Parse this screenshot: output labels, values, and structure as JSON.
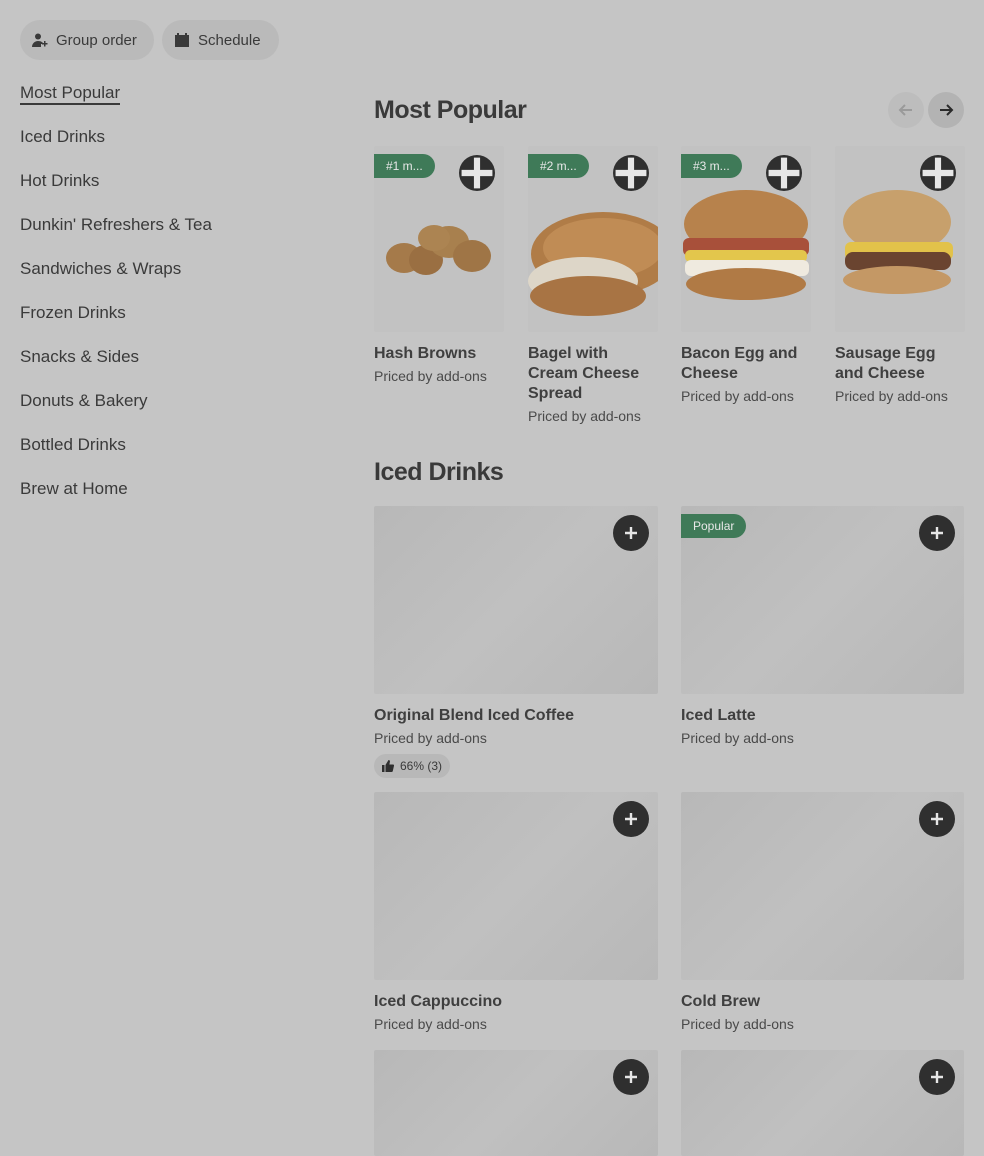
{
  "header": {
    "group_order_label": "Group order",
    "schedule_label": "Schedule"
  },
  "sidebar": {
    "items": [
      {
        "label": "Most Popular",
        "active": true
      },
      {
        "label": "Iced Drinks"
      },
      {
        "label": "Hot Drinks"
      },
      {
        "label": "Dunkin' Refreshers & Tea"
      },
      {
        "label": "Sandwiches & Wraps"
      },
      {
        "label": "Frozen Drinks"
      },
      {
        "label": "Snacks & Sides"
      },
      {
        "label": "Donuts & Bakery"
      },
      {
        "label": "Bottled Drinks"
      },
      {
        "label": "Brew at Home"
      }
    ]
  },
  "most_popular": {
    "title": "Most Popular",
    "items": [
      {
        "badge": "#1 m...",
        "name": "Hash Browns",
        "price": "Priced by add-ons",
        "icon": "hash-browns"
      },
      {
        "badge": "#2 m...",
        "name": "Bagel with Cream Cheese Spread",
        "price": "Priced by add-ons",
        "icon": "bagel"
      },
      {
        "badge": "#3 m...",
        "name": "Bacon Egg and Cheese",
        "price": "Priced by add-ons",
        "icon": "bacon-egg-sandwich"
      },
      {
        "badge": "",
        "name": "Sausage Egg and Cheese",
        "price": "Priced by add-ons",
        "icon": "sausage-sandwich"
      }
    ]
  },
  "iced_drinks": {
    "title": "Iced Drinks",
    "items": [
      {
        "badge": "",
        "name": "Original Blend Iced Coffee",
        "price": "Priced by add-ons",
        "rating": "66% (3)"
      },
      {
        "badge": "Popular",
        "name": "Iced Latte",
        "price": "Priced by add-ons"
      },
      {
        "badge": "",
        "name": "Iced Cappuccino",
        "price": "Priced by add-ons"
      },
      {
        "badge": "",
        "name": "Cold Brew",
        "price": "Priced by add-ons"
      },
      {
        "badge": "",
        "name": "",
        "price": ""
      },
      {
        "badge": "",
        "name": "",
        "price": ""
      }
    ]
  },
  "colors": {
    "badge_green": "#3f7a58",
    "add_button": "#2f2f2f",
    "overlay_bg": "#c5c5c5"
  }
}
